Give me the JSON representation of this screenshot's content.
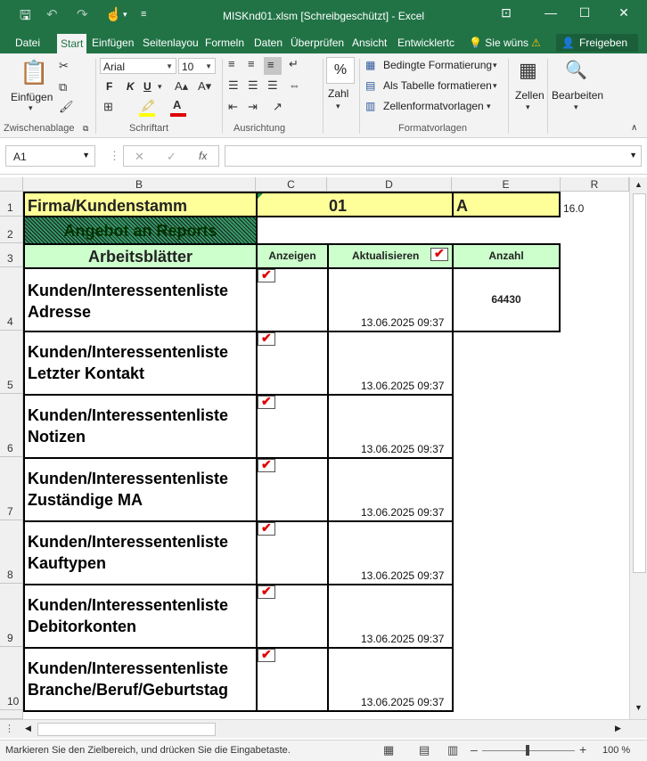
{
  "window": {
    "title": "MISKnd01.xlsm  [Schreibgeschützt] - Excel"
  },
  "tabs": [
    "Datei",
    "Start",
    "Einfügen",
    "Seitenlayou",
    "Formeln",
    "Daten",
    "Überprüfen",
    "Ansicht",
    "Entwicklertc"
  ],
  "tell_me": "Sie wüns",
  "share_label": "Freigeben",
  "ribbon": {
    "paste_label": "Einfügen",
    "clipboard_label": "Zwischenablage",
    "font_name": "Arial",
    "font_size": "10",
    "bold": "F",
    "italic": "K",
    "underline": "U",
    "font_label": "Schriftart",
    "alignment_label": "Ausrichtung",
    "number_symbol": "%",
    "number_label": "Zahl",
    "cond_format": "Bedingte Formatierung",
    "as_table": "Als Tabelle formatieren",
    "cell_styles": "Zellenformatvorlagen",
    "styles_label": "Formatvorlagen",
    "cells_label": "Zellen",
    "edit_label": "Bearbeiten"
  },
  "formula_bar": {
    "name_box": "A1",
    "fx": "fx",
    "value": ""
  },
  "columns": [
    "B",
    "C",
    "D",
    "E",
    "R"
  ],
  "sheet": {
    "row1": {
      "firma": "Firma/Kundenstamm",
      "code": "01",
      "letter": "A",
      "r_value": "16.0"
    },
    "row2": {
      "angebot": "Angebot an Reports"
    },
    "row3": {
      "arbeitsblaetter": "Arbeitsblätter",
      "anzeigen": "Anzeigen",
      "aktualisieren": "Aktualisieren",
      "anzahl": "Anzahl"
    },
    "reports": [
      {
        "row": "4",
        "line1": "Kunden/Interessentenliste",
        "line2": "Adresse",
        "anzeigen": true,
        "timestamp": "13.06.2025 09:37",
        "anzahl": "64430"
      },
      {
        "row": "5",
        "line1": "Kunden/Interessentenliste",
        "line2": "Letzter Kontakt",
        "anzeigen": true,
        "timestamp": "13.06.2025 09:37",
        "anzahl": ""
      },
      {
        "row": "6",
        "line1": "Kunden/Interessentenliste",
        "line2": "Notizen",
        "anzeigen": true,
        "timestamp": "13.06.2025 09:37",
        "anzahl": ""
      },
      {
        "row": "7",
        "line1": "Kunden/Interessentenliste",
        "line2": "Zuständige MA",
        "anzeigen": true,
        "timestamp": "13.06.2025 09:37",
        "anzahl": ""
      },
      {
        "row": "8",
        "line1": "Kunden/Interessentenliste",
        "line2": "Kauftypen",
        "anzeigen": true,
        "timestamp": "13.06.2025 09:37",
        "anzahl": ""
      },
      {
        "row": "9",
        "line1": "Kunden/Interessentenliste",
        "line2": "Debitorkonten",
        "anzeigen": true,
        "timestamp": "13.06.2025 09:37",
        "anzahl": ""
      },
      {
        "row": "10",
        "line1": "Kunden/Interessentenliste",
        "line2": "Branche/Beruf/Geburtstag",
        "anzeigen": true,
        "timestamp": "13.06.2025 09:37",
        "anzahl": ""
      }
    ]
  },
  "row_numbers": [
    "1",
    "2",
    "3"
  ],
  "status": {
    "message": "Markieren Sie den Zielbereich, und drücken Sie die Eingabetaste.",
    "zoom": "100 %"
  },
  "colors": {
    "excel_green": "#217346",
    "header_yellow": "#ffff99",
    "header_green": "#ccffcc",
    "angebot_teal": "#339966"
  }
}
